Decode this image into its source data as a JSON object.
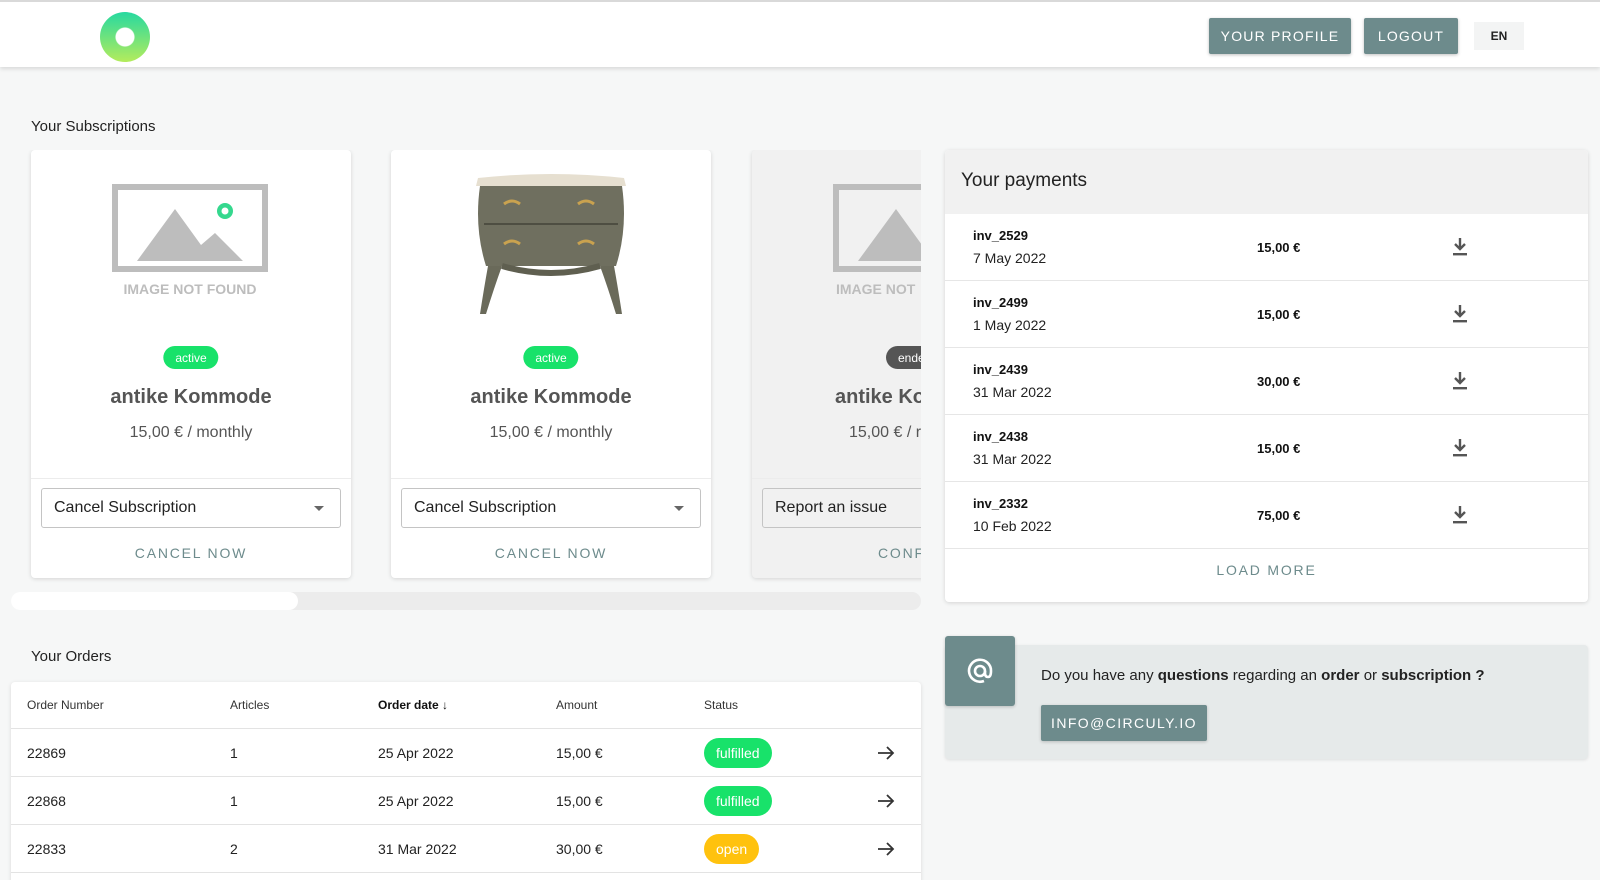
{
  "header": {
    "profile_label": "YOUR PROFILE",
    "logout_label": "LOGOUT",
    "language": "EN",
    "brand_color": "#6d8b8c"
  },
  "subscriptions": {
    "title": "Your Subscriptions",
    "cards": [
      {
        "image": "image-not-found",
        "image_text": "IMAGE NOT FOUND",
        "status": "active",
        "title": "antike Kommode",
        "price": "15,00 € / monthly",
        "select_value": "Cancel Subscription",
        "action": "CANCEL NOW"
      },
      {
        "image": "dresser",
        "status": "active",
        "title": "antike Kommode",
        "price": "15,00 € / monthly",
        "select_value": "Cancel Subscription",
        "action": "CANCEL NOW"
      },
      {
        "image": "image-not-found",
        "image_text": "IMAGE NOT",
        "status": "ende",
        "title": "antike Ko",
        "price": "15,00 € / r",
        "select_value": "Report an issue",
        "action": "CONFI"
      }
    ],
    "scroll_fraction": 0.315
  },
  "orders": {
    "title": "Your Orders",
    "columns": [
      "Order Number",
      "Articles",
      "Order date",
      "Amount",
      "Status"
    ],
    "rows": [
      {
        "number": "22869",
        "articles": "1",
        "date": "25 Apr 2022",
        "amount": "15,00 €",
        "status": "fulfilled"
      },
      {
        "number": "22868",
        "articles": "1",
        "date": "25 Apr 2022",
        "amount": "15,00 €",
        "status": "fulfilled"
      },
      {
        "number": "22833",
        "articles": "2",
        "date": "31 Mar 2022",
        "amount": "30,00 €",
        "status": "open"
      }
    ]
  },
  "payments": {
    "title": "Your payments",
    "rows": [
      {
        "invoice": "inv_2529",
        "date": "7 May 2022",
        "amount": "15,00 €"
      },
      {
        "invoice": "inv_2499",
        "date": "1 May 2022",
        "amount": "15,00 €"
      },
      {
        "invoice": "inv_2439",
        "date": "31 Mar 2022",
        "amount": "30,00 €"
      },
      {
        "invoice": "inv_2438",
        "date": "31 Mar 2022",
        "amount": "15,00 €"
      },
      {
        "invoice": "inv_2332",
        "date": "10 Feb 2022",
        "amount": "75,00 €"
      }
    ],
    "load_more": "LOAD MORE"
  },
  "contact": {
    "text_prefix": "Do you have any",
    "text_questions": "questions",
    "text_middle": "regarding an",
    "text_order": "order",
    "text_or": "or",
    "text_subscription": "subscription ?",
    "email_button": "INFO@CIRCULY.IO"
  }
}
